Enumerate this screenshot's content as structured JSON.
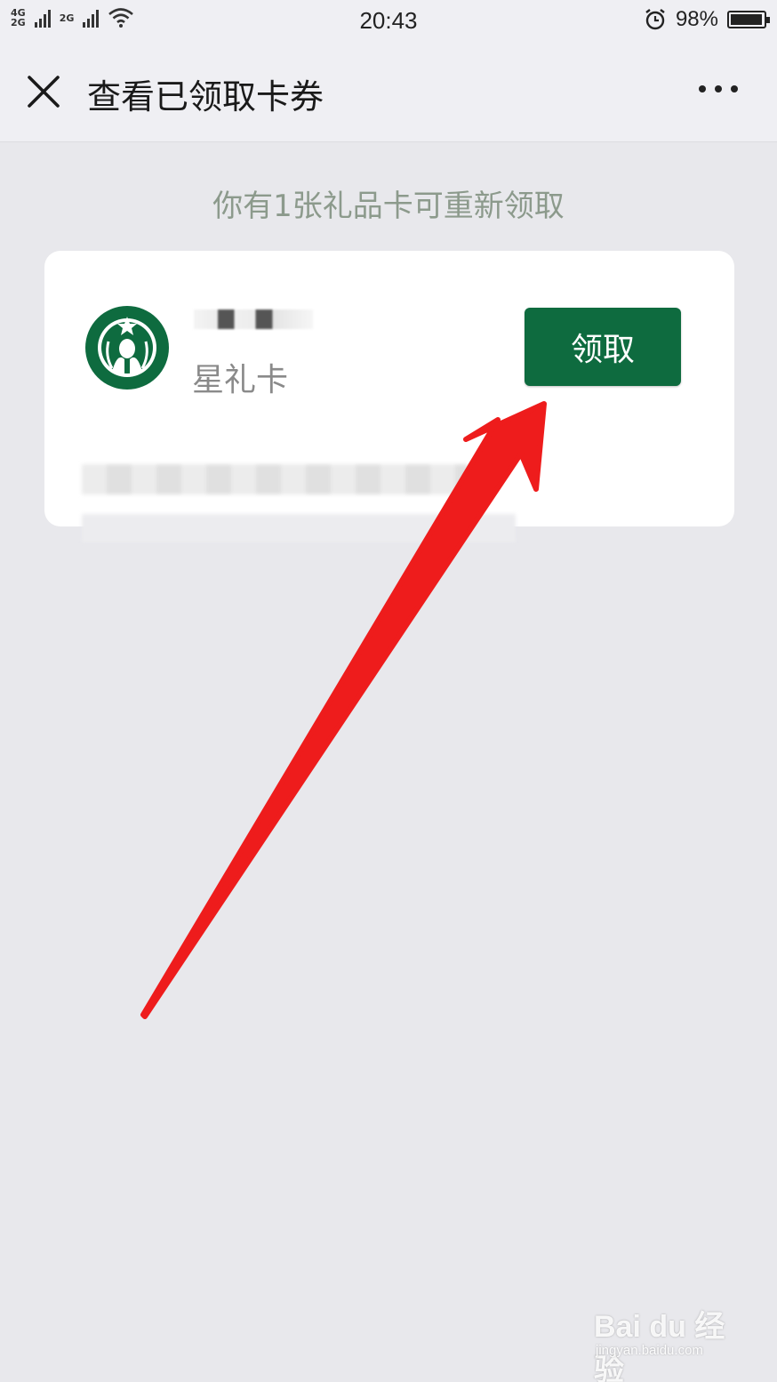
{
  "status_bar": {
    "network_1": "4G",
    "network_2": "2G",
    "network_3": "2G",
    "time": "20:43",
    "alarm_icon": "alarm-clock-icon",
    "battery_percent": "98%",
    "battery_level": 0.98
  },
  "nav": {
    "close_icon": "close-icon",
    "title": "查看已领取卡券",
    "more_icon": "more-icon"
  },
  "notice": "你有1张礼品卡可重新领取",
  "card": {
    "logo_icon": "starbucks-logo-icon",
    "type_label": "星礼卡",
    "claim_button": "领取"
  },
  "watermark": {
    "brand": "Bai du 经验",
    "site": "jingyan.baidu.com"
  },
  "colors": {
    "background": "#e8e8ec",
    "button_green": "#0e6b3f",
    "arrow_red": "#ee1c1c"
  }
}
